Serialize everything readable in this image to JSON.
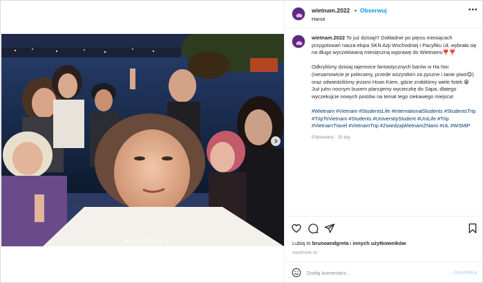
{
  "post": {
    "username": "wietnam.2022",
    "separator": "•",
    "follow_label": "Obserwuj",
    "location": "Hanoi",
    "more_label": "•••",
    "avatar_color": "#5b2a86"
  },
  "caption": {
    "username": "wietnam.2022",
    "para1": "To już dzisiaj!!! Dokładnie po pięciu miesiącach przygotowań nasza ekipa SKN Azji Wschodniej i Pacyfiku UŁ wybrała się na długo wyczekiwaną miesięczną wyprawę do Wietnamu❣️❣️",
    "para2": "Odkryliśmy dzisiaj tajemnice fantastycznych barów w Ha Noi (niesamowicie je polecamy, przede wszystkim za pyszne i tanie piwo😋) oraz odwiedziliśmy jezioro Hoan Kiem, gdzie zrobiliśmy wiele fotek 😁 Już jutro nocnym busem planujemy wycieczkę do Sapa, dlatego wyczekujcie nowych postów na temat tego ciekawego miejsca!",
    "hashtags": "#Wietnam #Vietnam #StudentsLife #InternationalStudents #StudentsTrip #TripToVietnam #Students #UniversityStudent #UniLife #Trip #VietnamTravel #VietnamTrip #ZwiedzajWietnamZNami #UŁ #WSMiP",
    "edited": "Edytowany · 15 tyg."
  },
  "actions": {
    "like_icon": "heart-icon",
    "comment_icon": "comment-icon",
    "share_icon": "share-icon",
    "save_icon": "bookmark-icon"
  },
  "likes": {
    "prefix": "Lubią to ",
    "user": "brunoandgreta",
    "middle": " i ",
    "others": "innych użytkowników"
  },
  "date": "SIERPNIA 30",
  "comment": {
    "placeholder": "Dodaj komentarz...",
    "post_label": "Opublikuj",
    "emoji_icon": "smiley-icon"
  },
  "carousel": {
    "slides": 8,
    "active": 1
  }
}
